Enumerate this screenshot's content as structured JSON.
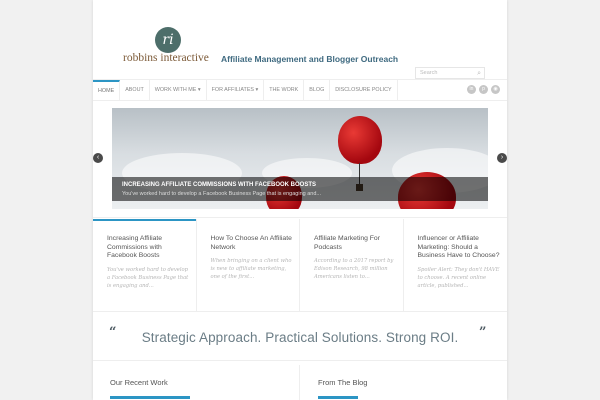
{
  "header": {
    "logo_mark": "ri",
    "logo_text": "robbins interactive",
    "tagline": "Affiliate Management and Blogger Outreach"
  },
  "nav": {
    "items": [
      {
        "label": "HOME",
        "active": true
      },
      {
        "label": "ABOUT"
      },
      {
        "label": "WORK WITH ME ▾"
      },
      {
        "label": "FOR AFFILIATES ▾"
      },
      {
        "label": "THE WORK"
      },
      {
        "label": "BLOG"
      },
      {
        "label": "DISCLOSURE POLICY"
      }
    ]
  },
  "search": {
    "placeholder": "Search",
    "icon": "search-icon"
  },
  "social": {
    "icons": [
      "linkedin-icon",
      "pinterest-icon",
      "rss-icon"
    ]
  },
  "slider": {
    "title": "INCREASING AFFILIATE COMMISSIONS WITH FACEBOOK BOOSTS",
    "text": "You've worked hard to develop a Facebook Business Page that is engaging and...",
    "prev_label": "‹",
    "next_label": "›"
  },
  "posts": [
    {
      "title": "Increasing Affiliate Commissions with Facebook Boosts",
      "excerpt": "You've worked hard to develop a Facebook Business Page that is engaging and..."
    },
    {
      "title": "How To Choose An Affiliate Network",
      "excerpt": "When bringing on a client who is new to affiliate marketing, one of the first..."
    },
    {
      "title": "Affiliate Marketing For Podcasts",
      "excerpt": "According to a 2017 report by Edison Research, 98 million Americans listen to..."
    },
    {
      "title": "Influencer or Affiliate Marketing: Should a Business Have to Choose?",
      "excerpt": "Spoiler Alert: They don't HAVE to choose. A recent online article, published..."
    }
  ],
  "quote": {
    "open": "“",
    "text": "Strategic Approach. Practical Solutions. Strong ROI.",
    "close": "”"
  },
  "sections": {
    "recent_work": "Our Recent Work",
    "from_blog": "From The Blog"
  },
  "colors": {
    "accent": "#2c95c4",
    "logo": "#4d6e6a",
    "tagline": "#3f6a80"
  }
}
